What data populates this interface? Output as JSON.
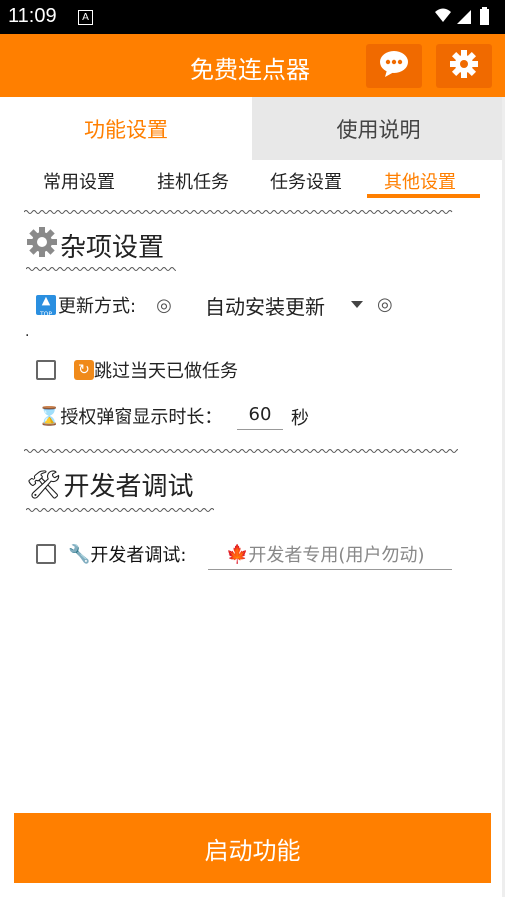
{
  "status_bar": {
    "time": "11:09",
    "notif_icon": "A"
  },
  "app_bar": {
    "title": "免费连点器",
    "chat_icon": "chat-bubble-icon",
    "settings_icon": "gear-icon"
  },
  "tabs": [
    {
      "label": "功能设置",
      "active": true
    },
    {
      "label": "使用说明",
      "active": false
    }
  ],
  "sub_tabs": [
    {
      "label": "常用设置",
      "active": false
    },
    {
      "label": "挂机任务",
      "active": false
    },
    {
      "label": "任务设置",
      "active": false
    },
    {
      "label": "其他设置",
      "active": true
    }
  ],
  "misc_section": {
    "title": "杂项设置",
    "update_label": "更新方式:",
    "update_value": "自动安装更新",
    "dot": ".",
    "skip_label": "跳过当天已做任务",
    "popup_label": "授权弹窗显示时长：",
    "popup_value": "60",
    "popup_unit": "秒"
  },
  "dev_section": {
    "title": "开发者调试",
    "debug_label": "开发者调试:",
    "debug_placeholder": "开发者专用(用户勿动)"
  },
  "start_button": "启动功能",
  "colors": {
    "accent": "#ff7f00",
    "accent_dark": "#f06a00"
  }
}
